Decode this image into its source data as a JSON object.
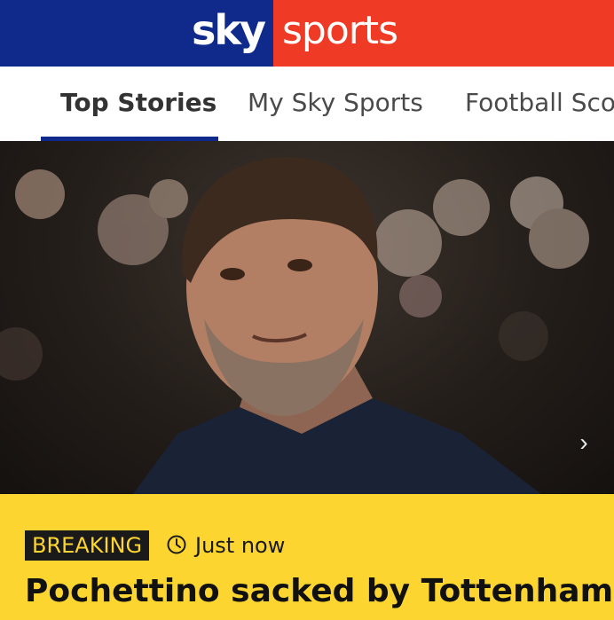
{
  "brand": {
    "logo_sky": "sky",
    "logo_sports": "sports"
  },
  "tabs": [
    {
      "label": "Top Stories",
      "active": true
    },
    {
      "label": "My Sky Sports",
      "active": false
    },
    {
      "label": "Football Sco",
      "active": false
    }
  ],
  "hero": {
    "next_icon": "chevron-right-icon"
  },
  "story": {
    "badge": "BREAKING",
    "time_icon": "clock-icon",
    "time": "Just now",
    "headline": "Pochettino sacked by Tottenham"
  },
  "colors": {
    "brand_blue": "#0f2a8a",
    "brand_red": "#ef3a25",
    "breaking_yellow": "#fcd530",
    "badge_black": "#1a1a1a"
  }
}
